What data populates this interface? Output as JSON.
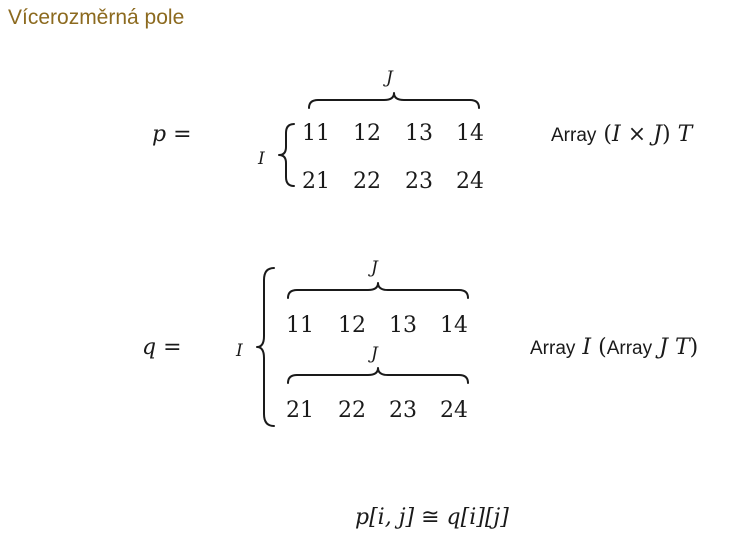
{
  "title": "Vícerozměrná pole",
  "p_block": {
    "lhs": "p =",
    "row_label": "I",
    "col_label": "J",
    "rows": [
      [
        "11",
        "12",
        "13",
        "14"
      ],
      [
        "21",
        "22",
        "23",
        "24"
      ]
    ],
    "type_word": "Array",
    "type_open": "(",
    "type_i": "I",
    "type_times": "×",
    "type_j": "J",
    "type_close": ")",
    "type_t": "T"
  },
  "q_block": {
    "lhs": "q =",
    "row_label": "I",
    "col_label_1": "J",
    "col_label_2": "J",
    "rows": [
      [
        "11",
        "12",
        "13",
        "14"
      ],
      [
        "21",
        "22",
        "23",
        "24"
      ]
    ],
    "type_word_1": "Array",
    "type_i": "I",
    "type_open": "(",
    "type_word_2": "Array",
    "type_j": "J",
    "type_t": "T",
    "type_close": ")"
  },
  "equivalence": {
    "left": "p[i, j]",
    "symbol": "≅",
    "right": "q[i][j]"
  }
}
